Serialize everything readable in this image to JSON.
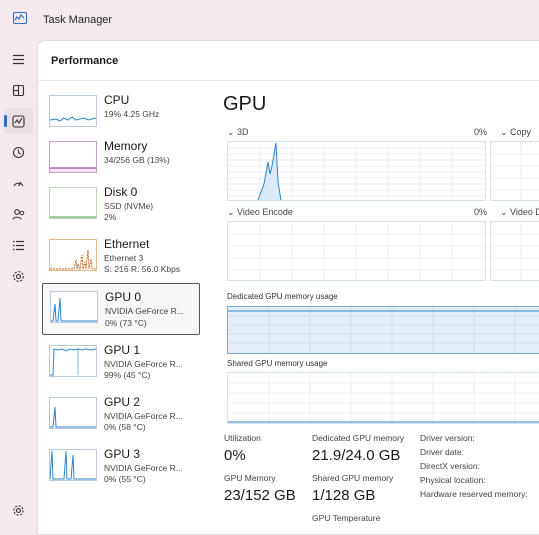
{
  "window": {
    "title": "Task Manager"
  },
  "rail": {
    "items": [
      "menu-icon",
      "processes-icon",
      "performance-icon",
      "app-history-icon",
      "startup-apps-icon",
      "users-icon",
      "details-icon",
      "services-icon",
      "settings-icon"
    ],
    "active": "performance-icon",
    "accent": "#2f6fbd"
  },
  "page": {
    "title": "Performance"
  },
  "sidebar": {
    "items": [
      {
        "name": "CPU",
        "line1": "19% 4.25 GHz",
        "line2": ""
      },
      {
        "name": "Memory",
        "line1": "34/256 GB (13%)",
        "line2": ""
      },
      {
        "name": "Disk 0",
        "line1": "SSD (NVMe)",
        "line2": "2%"
      },
      {
        "name": "Ethernet",
        "line1": "Ethernet 3",
        "line2": "S: 216 R: 56.0 Kbps"
      },
      {
        "name": "GPU 0",
        "line1": "NVIDIA GeForce R...",
        "line2": "0% (73 °C)"
      },
      {
        "name": "GPU 1",
        "line1": "NVIDIA GeForce R...",
        "line2": "99% (45 °C)"
      },
      {
        "name": "GPU 2",
        "line1": "NVIDIA GeForce R...",
        "line2": "0% (58 °C)"
      },
      {
        "name": "GPU 3",
        "line1": "NVIDIA GeForce R...",
        "line2": "0% (55 °C)"
      }
    ],
    "selected_index": 4
  },
  "gpu": {
    "title": "GPU",
    "engines": [
      {
        "label": "3D",
        "pct": "0%"
      },
      {
        "label": "Copy",
        "pct": ""
      },
      {
        "label": "Video Encode",
        "pct": "0%"
      },
      {
        "label": "Video D",
        "pct": ""
      }
    ],
    "dedicated_label": "Dedicated GPU memory usage",
    "shared_label": "Shared GPU memory usage",
    "stats": {
      "utilization_label": "Utilization",
      "utilization_value": "0%",
      "dedicated_label": "Dedicated GPU memory",
      "dedicated_value": "21.9/24.0 GB",
      "gpu_memory_label": "GPU Memory",
      "gpu_memory_value": "23/152 GB",
      "shared_label": "Shared GPU memory",
      "shared_value": "1/128 GB",
      "temperature_label": "GPU Temperature"
    },
    "driver": {
      "version_label": "Driver version:",
      "date_label": "Driver date:",
      "directx_label": "DirectX version:",
      "location_label": "Physical location:",
      "reserved_label": "Hardware reserved memory:"
    }
  },
  "colors": {
    "gpu_line": "#2f83c9",
    "memory": "#a64ea6",
    "ethernet": "#c66a2a"
  }
}
